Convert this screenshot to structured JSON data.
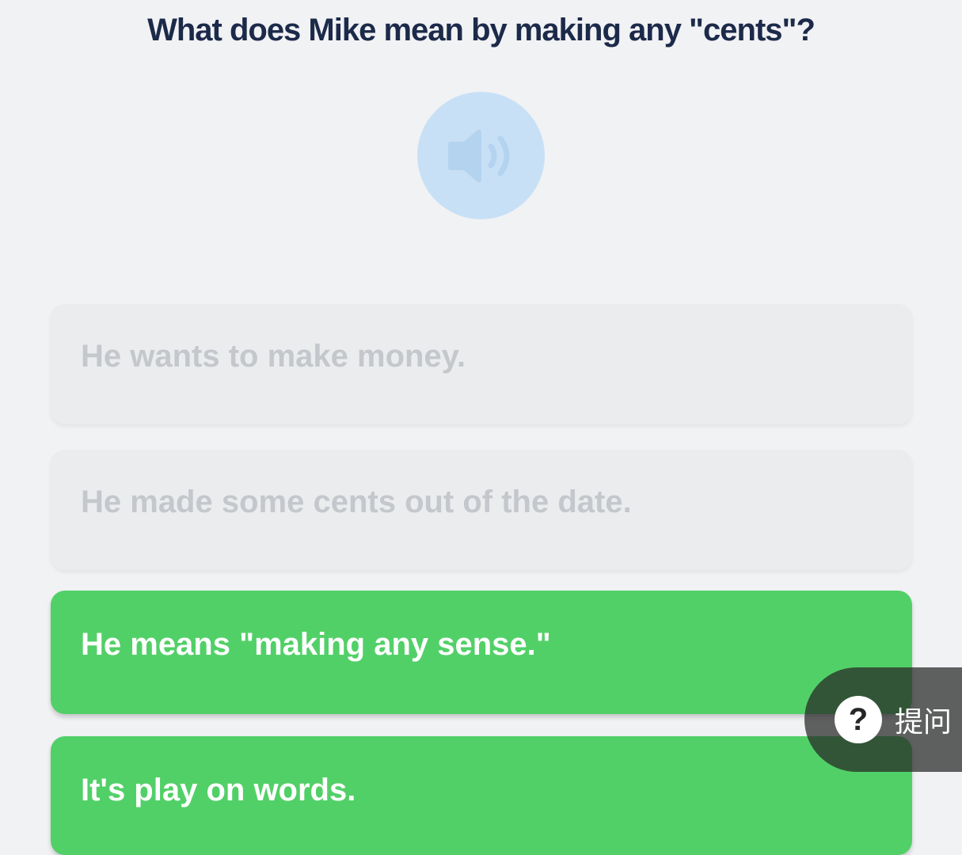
{
  "question": "What does Mike mean by making any \"cents\"?",
  "audio": {
    "icon": "speaker-icon"
  },
  "options": [
    {
      "label": "He wants to make money.",
      "state": "disabled"
    },
    {
      "label": "He made some cents out of the date.",
      "state": "disabled"
    },
    {
      "label": "He means \"making any sense.\"",
      "state": "correct"
    },
    {
      "label": "It's play on words.",
      "state": "correct"
    }
  ],
  "ask_button": {
    "icon": "question-mark-icon",
    "icon_glyph": "?",
    "label": "提问"
  },
  "colors": {
    "background": "#f1f2f4",
    "title": "#1c2a4a",
    "audio_circle": "#c7e0f6",
    "correct_option": "#52d068",
    "disabled_option": "#ebecee",
    "disabled_text": "#c4c7cc"
  }
}
